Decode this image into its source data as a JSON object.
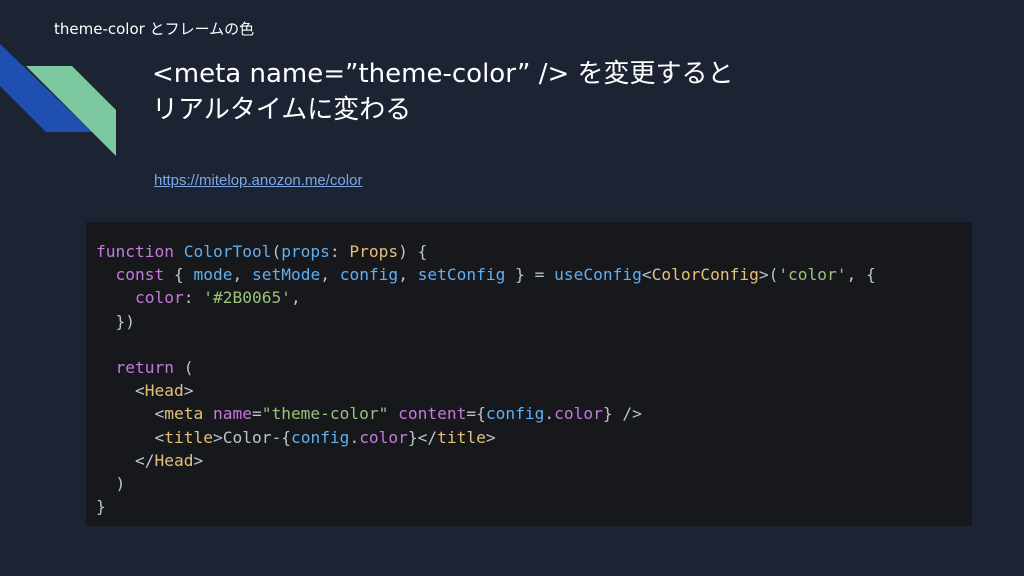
{
  "slide": {
    "label": "theme-color とフレームの色",
    "title_line1": "<meta name=”theme-color” /> を変更すると",
    "title_line2": "リアルタイムに変わる",
    "link": "https://mitelop.anozon.me/color"
  },
  "code": {
    "l1": {
      "kw": "function",
      "fn": "ColorTool",
      "open": "(",
      "arg": "props",
      "colon": ":",
      "type": "Props",
      "close": ") {"
    },
    "l2": {
      "kw": "const",
      "b1": "{ ",
      "v1": "mode",
      ",1": ", ",
      "v2": "setMode",
      ",2": ", ",
      "v3": "config",
      ",3": ", ",
      "v4": "setConfig",
      "b2": " } = ",
      "call": "useConfig",
      "lt": "<",
      "gen": "ColorConfig",
      "gt": ">",
      "args": "(",
      "s1": "'color'",
      "rest": ", {"
    },
    "l3": {
      "prop": "color",
      "colon": ": ",
      "str": "'#2B0065'",
      "comma": ","
    },
    "l4": {
      "text": "})"
    },
    "l5": {
      "text": ""
    },
    "l6": {
      "kw": "return",
      "rest": " ("
    },
    "l7": {
      "lt": "<",
      "tag": "Head",
      "gt": ">"
    },
    "l8": {
      "lt": "<",
      "tag": "meta",
      "sp": " ",
      "a1": "name",
      "eq1": "=",
      "s1": "\"theme-color\"",
      "sp2": " ",
      "a2": "content",
      "eq2": "={",
      "obj": "config",
      "dot": ".",
      "prop": "color",
      "end": "} />"
    },
    "l9": {
      "lt": "<",
      "tag": "title",
      "gt": ">",
      "text": "Color-{",
      "obj": "config",
      "dot": ".",
      "prop": "color",
      "mid": "}</",
      "tag2": "title",
      "gt2": ">"
    },
    "l10": {
      "lt": "</",
      "tag": "Head",
      "gt": ">"
    },
    "l11": {
      "text": ")"
    },
    "l12": {
      "text": "}"
    }
  },
  "colors": {
    "background": "#1c2333",
    "code_background": "#17181c",
    "accent_blue": "#1f4fb3",
    "accent_green": "#7cc9a0",
    "link": "#7ea7e6"
  }
}
